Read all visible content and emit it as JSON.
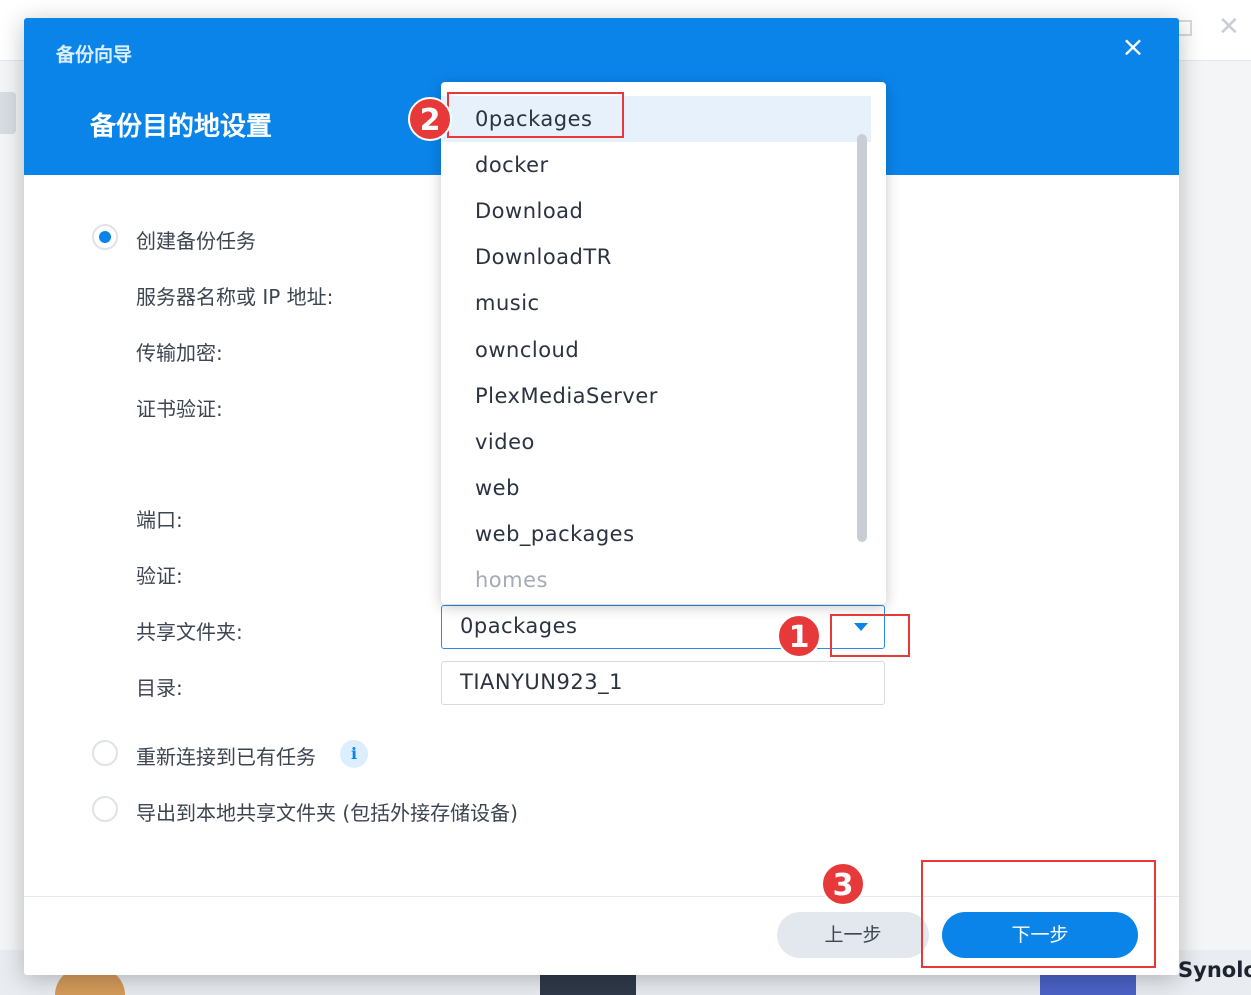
{
  "background": {
    "bottom_app_text": "Synolo"
  },
  "dialog": {
    "title": "备份向导",
    "subtitle": "备份目的地设置",
    "close_icon": "×",
    "options": {
      "create_task": "创建备份任务",
      "reconnect_task": "重新连接到已有任务",
      "export_local": "导出到本地共享文件夹 (包括外接存储设备)"
    },
    "labels": {
      "server": "服务器名称或 IP 地址:",
      "encryption": "传输加密:",
      "certificate": "证书验证:",
      "port": "端口:",
      "auth": "验证:",
      "shared_folder": "共享文件夹:",
      "directory": "目录:"
    },
    "fields": {
      "shared_folder_value": "0packages",
      "directory_value": "TIANYUN923_1"
    },
    "info_icon": "i",
    "buttons": {
      "prev": "上一步",
      "next": "下一步"
    }
  },
  "dropdown": {
    "items": [
      "0packages",
      "docker",
      "Download",
      "DownloadTR",
      "music",
      "owncloud",
      "PlexMediaServer",
      "video",
      "web",
      "web_packages",
      "homes"
    ],
    "selected": "0packages"
  },
  "annotations": [
    "1",
    "2",
    "3"
  ],
  "colors": {
    "accent": "#0b84ea",
    "annotation": "#e8393a"
  }
}
